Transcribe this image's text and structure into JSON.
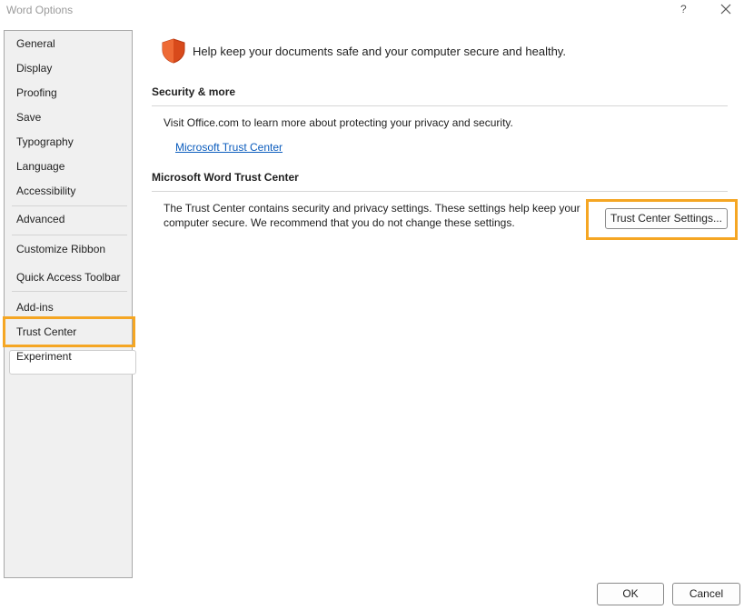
{
  "window": {
    "title": "Word Options",
    "help_label": "?"
  },
  "sidebar": {
    "items": [
      {
        "label": "General"
      },
      {
        "label": "Display"
      },
      {
        "label": "Proofing"
      },
      {
        "label": "Save"
      },
      {
        "label": "Typography"
      },
      {
        "label": "Language"
      },
      {
        "label": "Accessibility"
      },
      {
        "label": "Advanced"
      },
      {
        "label": "Customize Ribbon"
      },
      {
        "label": "Quick Access Toolbar"
      },
      {
        "label": "Add-ins"
      },
      {
        "label": "Trust Center"
      },
      {
        "label": "Experiment"
      }
    ],
    "selected": "Trust Center"
  },
  "main": {
    "headline": "Help keep your documents safe and your computer secure and healthy.",
    "security": {
      "title": "Security & more",
      "text": "Visit Office.com to learn more about protecting your privacy and security.",
      "link": "Microsoft Trust Center"
    },
    "trust_center": {
      "title": "Microsoft Word Trust Center",
      "text": "The Trust Center contains security and privacy settings. These settings help keep your computer secure. We recommend that you do not change these settings.",
      "button_label": "Trust Center Settings..."
    }
  },
  "footer": {
    "ok_label": "OK",
    "cancel_label": "Cancel"
  },
  "colors": {
    "highlight": "#f5a623",
    "shield": "#d84a1b",
    "link": "#0b5cbd"
  }
}
